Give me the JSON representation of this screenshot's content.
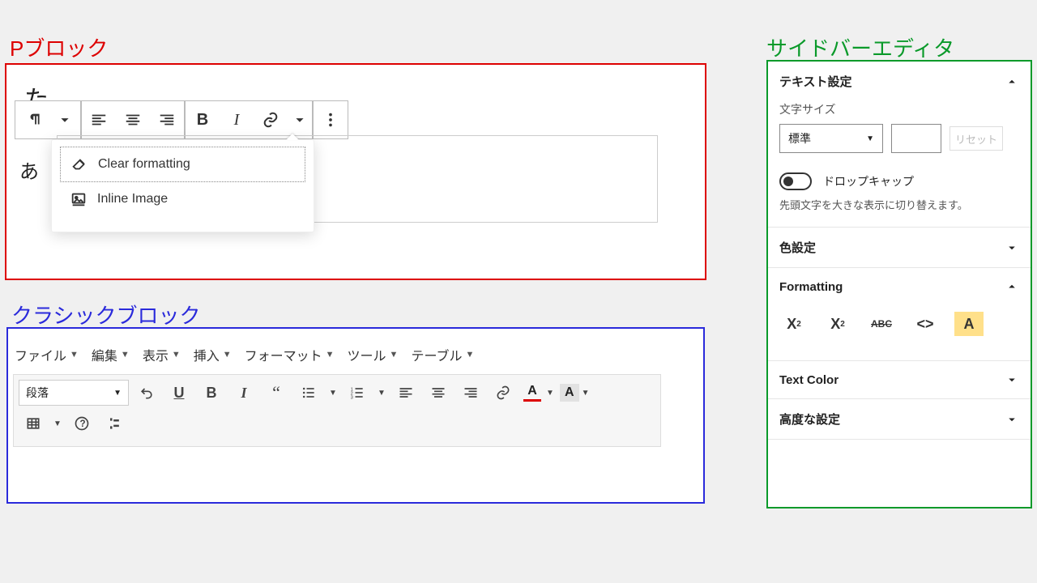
{
  "labels": {
    "p_block": "Pブロック",
    "classic_block": "クラシックブロック",
    "sidebar_editor": "サイドバーエディタ"
  },
  "p_block": {
    "content_char": "あ",
    "dropdown": {
      "clear_formatting": "Clear formatting",
      "inline_image": "Inline Image"
    }
  },
  "classic": {
    "menus": [
      "ファイル",
      "編集",
      "表示",
      "挿入",
      "フォーマット",
      "ツール",
      "テーブル"
    ],
    "paragraph_select": "段落",
    "text_color_letter": "A",
    "bg_color_letter": "A"
  },
  "sidebar": {
    "text_settings": {
      "title": "テキスト設定",
      "font_size_label": "文字サイズ",
      "font_size_value": "標準",
      "reset": "リセット",
      "dropcap_label": "ドロップキャップ",
      "dropcap_hint": "先頭文字を大きな表示に切り替えます。"
    },
    "color_settings_title": "色設定",
    "formatting_title": "Formatting",
    "formatting_icons": {
      "abc": "ABC",
      "a": "A"
    },
    "text_color_title": "Text Color",
    "advanced_title": "高度な設定"
  }
}
